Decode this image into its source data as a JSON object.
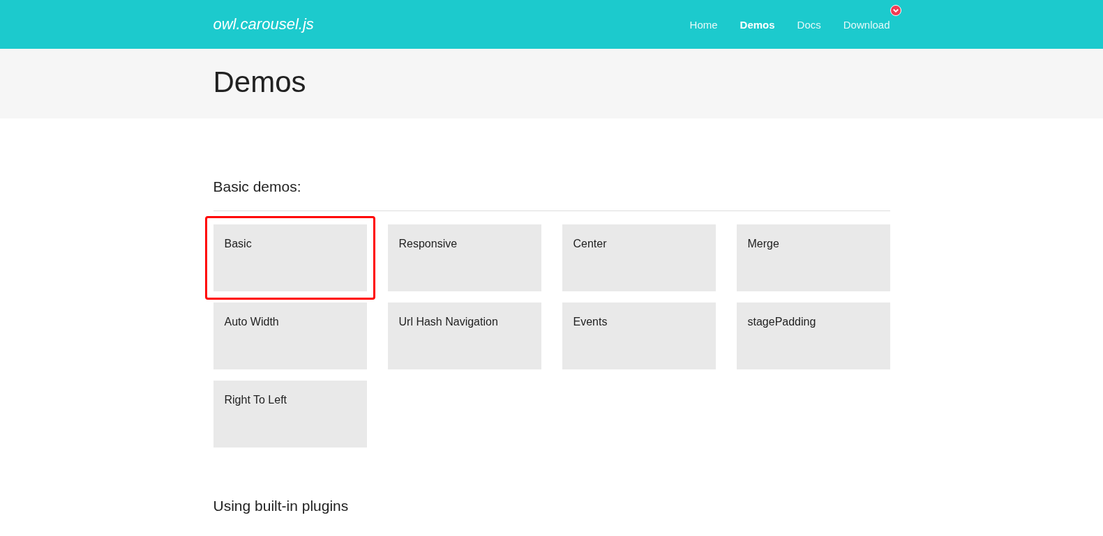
{
  "header": {
    "logo": "owl.carousel.js",
    "nav": [
      {
        "label": "Home",
        "selected": false,
        "badge": false
      },
      {
        "label": "Demos",
        "selected": true,
        "badge": false
      },
      {
        "label": "Docs",
        "selected": false,
        "badge": false
      },
      {
        "label": "Download",
        "selected": false,
        "badge": true
      }
    ]
  },
  "page_title": "Demos",
  "sections": [
    {
      "heading": "Basic demos:",
      "demos": [
        {
          "label": "Basic",
          "highlighted": true
        },
        {
          "label": "Responsive",
          "highlighted": false
        },
        {
          "label": "Center",
          "highlighted": false
        },
        {
          "label": "Merge",
          "highlighted": false
        },
        {
          "label": "Auto Width",
          "highlighted": false
        },
        {
          "label": "Url Hash Navigation",
          "highlighted": false
        },
        {
          "label": "Events",
          "highlighted": false
        },
        {
          "label": "stagePadding",
          "highlighted": false
        },
        {
          "label": "Right To Left",
          "highlighted": false
        }
      ]
    },
    {
      "heading": "Using built-in plugins"
    }
  ]
}
